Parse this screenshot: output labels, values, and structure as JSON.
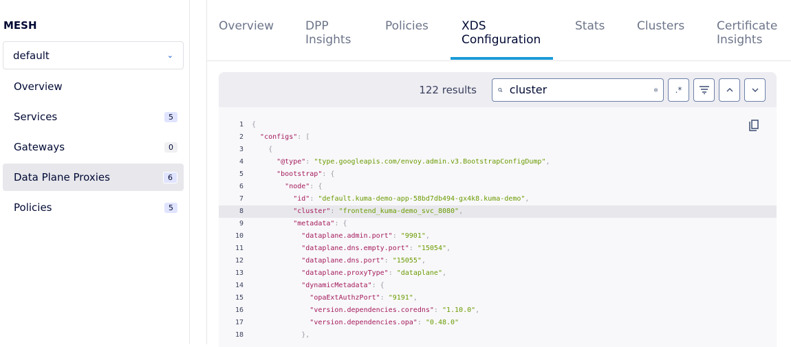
{
  "sidebar": {
    "mesh_label": "MESH",
    "mesh_select": "default",
    "items": [
      {
        "label": "Overview",
        "count": null
      },
      {
        "label": "Services",
        "count": "5"
      },
      {
        "label": "Gateways",
        "count": "0"
      },
      {
        "label": "Data Plane Proxies",
        "count": "6",
        "active": true
      },
      {
        "label": "Policies",
        "count": "5"
      }
    ]
  },
  "tabs": [
    "Overview",
    "DPP Insights",
    "Policies",
    "XDS Configuration",
    "Stats",
    "Clusters",
    "Certificate Insights"
  ],
  "active_tab": "XDS Configuration",
  "search": {
    "results": "122 results",
    "query": "cluster",
    "regex_label": ".*"
  },
  "code": [
    {
      "n": "1",
      "indent": 0,
      "parts": [
        [
          "p",
          "{"
        ]
      ]
    },
    {
      "n": "2",
      "indent": 1,
      "parts": [
        [
          "k",
          "\"configs\""
        ],
        [
          "p",
          ": ["
        ]
      ]
    },
    {
      "n": "3",
      "indent": 2,
      "parts": [
        [
          "p",
          "{"
        ]
      ]
    },
    {
      "n": "4",
      "indent": 3,
      "parts": [
        [
          "k",
          "\"@type\""
        ],
        [
          "p",
          ": "
        ],
        [
          "s",
          "\"type.googleapis.com/envoy.admin.v3.BootstrapConfigDump\""
        ],
        [
          "p",
          ","
        ]
      ]
    },
    {
      "n": "5",
      "indent": 3,
      "parts": [
        [
          "k",
          "\"bootstrap\""
        ],
        [
          "p",
          ": {"
        ]
      ]
    },
    {
      "n": "6",
      "indent": 4,
      "parts": [
        [
          "k",
          "\"node\""
        ],
        [
          "p",
          ": {"
        ]
      ]
    },
    {
      "n": "7",
      "indent": 5,
      "parts": [
        [
          "k",
          "\"id\""
        ],
        [
          "p",
          ": "
        ],
        [
          "s",
          "\"default.kuma-demo-app-58bd7db494-gx4k8.kuma-demo\""
        ],
        [
          "p",
          ","
        ]
      ]
    },
    {
      "n": "8",
      "indent": 5,
      "hl": true,
      "parts": [
        [
          "k",
          "\"cluster\""
        ],
        [
          "p",
          ": "
        ],
        [
          "s",
          "\"frontend_kuma-demo_svc_8080\""
        ],
        [
          "p",
          ","
        ]
      ]
    },
    {
      "n": "9",
      "indent": 5,
      "parts": [
        [
          "k",
          "\"metadata\""
        ],
        [
          "p",
          ": {"
        ]
      ]
    },
    {
      "n": "10",
      "indent": 6,
      "parts": [
        [
          "k",
          "\"dataplane.admin.port\""
        ],
        [
          "p",
          ": "
        ],
        [
          "s",
          "\"9901\""
        ],
        [
          "p",
          ","
        ]
      ]
    },
    {
      "n": "11",
      "indent": 6,
      "parts": [
        [
          "k",
          "\"dataplane.dns.empty.port\""
        ],
        [
          "p",
          ": "
        ],
        [
          "s",
          "\"15054\""
        ],
        [
          "p",
          ","
        ]
      ]
    },
    {
      "n": "12",
      "indent": 6,
      "parts": [
        [
          "k",
          "\"dataplane.dns.port\""
        ],
        [
          "p",
          ": "
        ],
        [
          "s",
          "\"15055\""
        ],
        [
          "p",
          ","
        ]
      ]
    },
    {
      "n": "13",
      "indent": 6,
      "parts": [
        [
          "k",
          "\"dataplane.proxyType\""
        ],
        [
          "p",
          ": "
        ],
        [
          "s",
          "\"dataplane\""
        ],
        [
          "p",
          ","
        ]
      ]
    },
    {
      "n": "14",
      "indent": 6,
      "parts": [
        [
          "k",
          "\"dynamicMetadata\""
        ],
        [
          "p",
          ": {"
        ]
      ]
    },
    {
      "n": "15",
      "indent": 7,
      "parts": [
        [
          "k",
          "\"opaExtAuthzPort\""
        ],
        [
          "p",
          ": "
        ],
        [
          "s",
          "\"9191\""
        ],
        [
          "p",
          ","
        ]
      ]
    },
    {
      "n": "16",
      "indent": 7,
      "parts": [
        [
          "k",
          "\"version.dependencies.coredns\""
        ],
        [
          "p",
          ": "
        ],
        [
          "s",
          "\"1.10.0\""
        ],
        [
          "p",
          ","
        ]
      ]
    },
    {
      "n": "17",
      "indent": 7,
      "parts": [
        [
          "k",
          "\"version.dependencies.opa\""
        ],
        [
          "p",
          ": "
        ],
        [
          "s",
          "\"0.48.0\""
        ]
      ]
    },
    {
      "n": "18",
      "indent": 6,
      "parts": [
        [
          "p",
          "},"
        ]
      ]
    }
  ]
}
